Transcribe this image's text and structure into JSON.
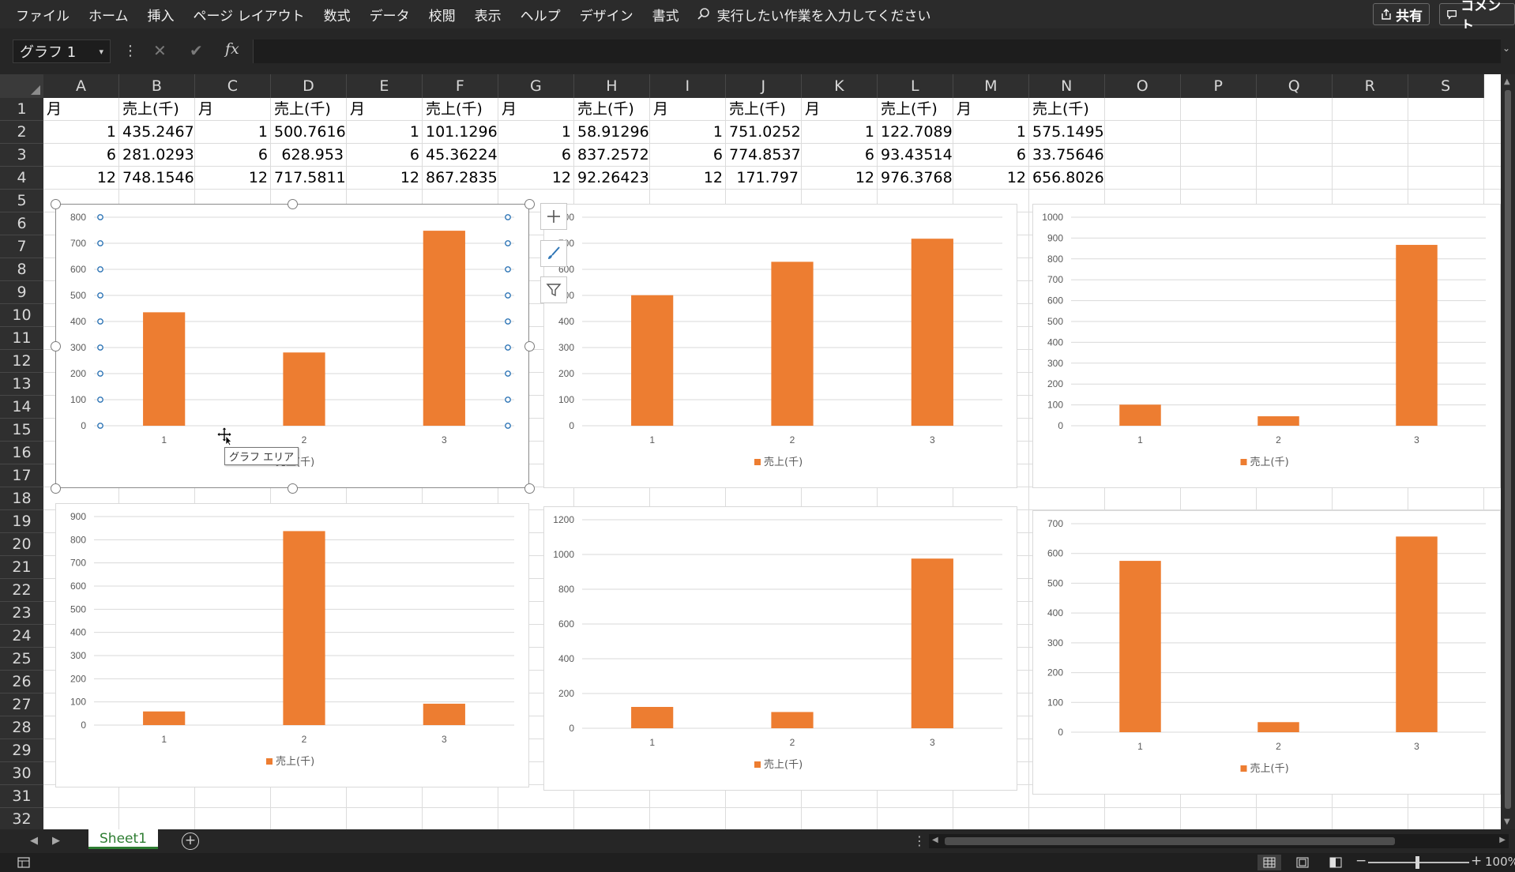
{
  "menu": {
    "items": [
      "ファイル",
      "ホーム",
      "挿入",
      "ページ レイアウト",
      "数式",
      "データ",
      "校閲",
      "表示",
      "ヘルプ",
      "デザイン",
      "書式"
    ],
    "search_placeholder": "実行したい作業を入力してください",
    "share_label": "共有",
    "comment_label": "コメント"
  },
  "formula_bar": {
    "name_box": "グラフ 1",
    "fx_label": "fx",
    "value": ""
  },
  "columns": [
    "A",
    "B",
    "C",
    "D",
    "E",
    "F",
    "G",
    "H",
    "I",
    "J",
    "K",
    "L",
    "M",
    "N",
    "O",
    "P",
    "Q",
    "R",
    "S"
  ],
  "rows": [
    "1",
    "2",
    "3",
    "4",
    "5",
    "6",
    "7",
    "8",
    "9",
    "10",
    "11",
    "12",
    "13",
    "14",
    "15",
    "16",
    "17",
    "18",
    "19",
    "20",
    "21",
    "22",
    "23",
    "24",
    "25",
    "26",
    "27",
    "28",
    "29",
    "30",
    "31",
    "32"
  ],
  "cells": [
    [
      "月",
      "売上(千)",
      "月",
      "売上(千)",
      "月",
      "売上(千)",
      "月",
      "売上(千)",
      "月",
      "売上(千)",
      "月",
      "売上(千)",
      "月",
      "売上(千)"
    ],
    [
      "1",
      "435.2467",
      "1",
      "500.7616",
      "1",
      "101.1296",
      "1",
      "58.91296",
      "1",
      "751.0252",
      "1",
      "122.7089",
      "1",
      "575.1495"
    ],
    [
      "6",
      "281.0293",
      "6",
      "628.953",
      "6",
      "45.36224",
      "6",
      "837.2572",
      "6",
      "774.8537",
      "6",
      "93.43514",
      "6",
      "33.75646"
    ],
    [
      "12",
      "748.1546",
      "12",
      "717.5811",
      "12",
      "867.2835",
      "12",
      "92.26423",
      "12",
      "171.797",
      "12",
      "976.3768",
      "12",
      "656.8026"
    ]
  ],
  "chart_data": [
    {
      "type": "bar",
      "categories": [
        "1",
        "2",
        "3"
      ],
      "series": [
        {
          "name": "売上(千)",
          "values": [
            435.2467,
            281.0293,
            748.1546
          ]
        }
      ],
      "ylim": [
        0,
        800
      ],
      "yticks": [
        0,
        100,
        200,
        300,
        400,
        500,
        600,
        700,
        800
      ],
      "legend": "bottom",
      "grid": true
    },
    {
      "type": "bar",
      "categories": [
        "1",
        "2",
        "3"
      ],
      "series": [
        {
          "name": "売上(千)",
          "values": [
            500.7616,
            628.953,
            717.5811
          ]
        }
      ],
      "ylim": [
        0,
        800
      ],
      "yticks": [
        0,
        100,
        200,
        300,
        400,
        500,
        600,
        700,
        800
      ],
      "legend": "bottom",
      "grid": true
    },
    {
      "type": "bar",
      "categories": [
        "1",
        "2",
        "3"
      ],
      "series": [
        {
          "name": "売上(千)",
          "values": [
            101.1296,
            45.36224,
            867.2835
          ]
        }
      ],
      "ylim": [
        0,
        1000
      ],
      "yticks": [
        0,
        100,
        200,
        300,
        400,
        500,
        600,
        700,
        800,
        900,
        1000
      ],
      "legend": "bottom",
      "grid": true
    },
    {
      "type": "bar",
      "categories": [
        "1",
        "2",
        "3"
      ],
      "series": [
        {
          "name": "売上(千)",
          "values": [
            58.91296,
            837.2572,
            92.26423
          ]
        }
      ],
      "ylim": [
        0,
        900
      ],
      "yticks": [
        0,
        100,
        200,
        300,
        400,
        500,
        600,
        700,
        800,
        900
      ],
      "legend": "bottom",
      "grid": true
    },
    {
      "type": "bar",
      "categories": [
        "1",
        "2",
        "3"
      ],
      "series": [
        {
          "name": "売上(千)",
          "values": [
            122.7089,
            93.43514,
            976.3768
          ]
        }
      ],
      "ylim": [
        0,
        1200
      ],
      "yticks": [
        0,
        200,
        400,
        600,
        800,
        1000,
        1200
      ],
      "legend": "bottom",
      "grid": true
    },
    {
      "type": "bar",
      "categories": [
        "1",
        "2",
        "3"
      ],
      "series": [
        {
          "name": "売上(千)",
          "values": [
            575.1495,
            33.75646,
            656.8026
          ]
        }
      ],
      "ylim": [
        0,
        700
      ],
      "yticks": [
        0,
        100,
        200,
        300,
        400,
        500,
        600,
        700
      ],
      "legend": "bottom",
      "grid": true
    }
  ],
  "chart_colors": {
    "bar": "#ED7D31",
    "gridline": "#D9D9D9",
    "axis_text": "#595959",
    "selection_dot": "#2E75B6"
  },
  "tooltip": "グラフ エリア",
  "sheet_tab": "Sheet1",
  "status": {
    "zoom": "100%"
  }
}
